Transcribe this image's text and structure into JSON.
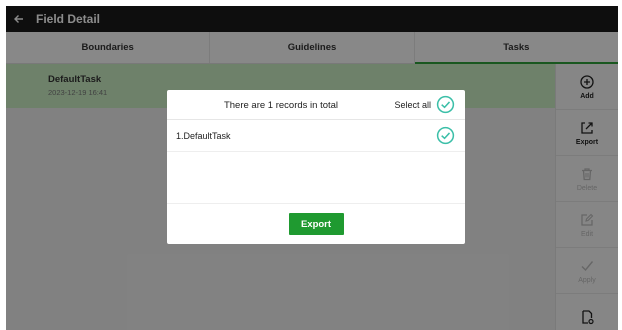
{
  "header": {
    "title": "Field Detail",
    "back_icon": "arrow-left-icon"
  },
  "tabs": [
    {
      "label": "Boundaries",
      "active": false
    },
    {
      "label": "Guidelines",
      "active": false
    },
    {
      "label": "Tasks",
      "active": true
    }
  ],
  "task": {
    "name": "DefaultTask",
    "date": "2023-12-19 16:41"
  },
  "side_actions": [
    {
      "label": "Add",
      "icon": "plus-circle-icon",
      "enabled": true
    },
    {
      "label": "Export",
      "icon": "export-icon",
      "enabled": true
    },
    {
      "label": "Delete",
      "icon": "trash-icon",
      "enabled": false
    },
    {
      "label": "Edit",
      "icon": "edit-icon",
      "enabled": false
    },
    {
      "label": "Apply",
      "icon": "checkmark-icon",
      "enabled": false
    },
    {
      "label": "",
      "icon": "document-settings-icon",
      "enabled": false
    }
  ],
  "dialog": {
    "title": "There are 1 records in total",
    "select_all_label": "Select all",
    "records": [
      {
        "label": "1.DefaultTask",
        "checked": true
      }
    ],
    "export_label": "Export"
  },
  "colors": {
    "accent": "#1f9a30",
    "check": "#3bbfa8",
    "selected_row": "#c9ecc2",
    "topbar": "#1a1a1a"
  }
}
